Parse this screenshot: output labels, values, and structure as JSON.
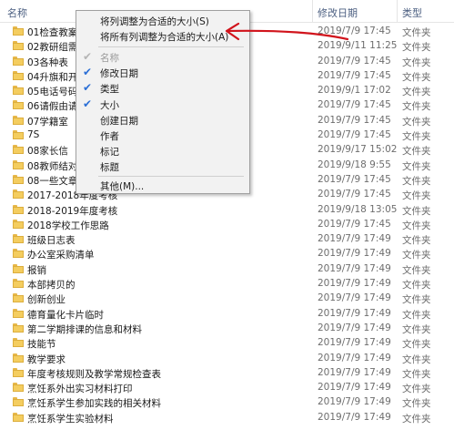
{
  "header": {
    "name_label": "名称",
    "date_label": "修改日期",
    "type_label": "类型"
  },
  "files": [
    {
      "name": "01检查教案、",
      "date": "2019/7/9 17:45",
      "type": "文件夹"
    },
    {
      "name": "02教研组需要",
      "date": "2019/9/11 11:25",
      "type": "文件夹"
    },
    {
      "name": "03各种表",
      "date": "2019/7/9 17:45",
      "type": "文件夹"
    },
    {
      "name": "04升旗和开会",
      "date": "2019/7/9 17:45",
      "type": "文件夹"
    },
    {
      "name": "05电话号码",
      "date": "2019/9/1 17:02",
      "type": "文件夹"
    },
    {
      "name": "06请假由请表",
      "date": "2019/7/9 17:45",
      "type": "文件夹"
    },
    {
      "name": "07学籍室",
      "date": "2019/7/9 17:45",
      "type": "文件夹"
    },
    {
      "name": "7S",
      "date": "2019/7/9 17:45",
      "type": "文件夹"
    },
    {
      "name": "08家长信",
      "date": "2019/9/17 15:02",
      "type": "文件夹"
    },
    {
      "name": "08教师结对子",
      "date": "2019/9/18 9:55",
      "type": "文件夹"
    },
    {
      "name": "08一些文章",
      "date": "2019/7/9 17:45",
      "type": "文件夹"
    },
    {
      "name": "2017-2018年度考核",
      "date": "2019/7/9 17:45",
      "type": "文件夹"
    },
    {
      "name": "2018-2019年度考核",
      "date": "2019/9/18 13:05",
      "type": "文件夹"
    },
    {
      "name": "2018学校工作思路",
      "date": "2019/7/9 17:45",
      "type": "文件夹"
    },
    {
      "name": "班级日志表",
      "date": "2019/7/9 17:49",
      "type": "文件夹"
    },
    {
      "name": "办公室采购清单",
      "date": "2019/7/9 17:49",
      "type": "文件夹"
    },
    {
      "name": "报销",
      "date": "2019/7/9 17:49",
      "type": "文件夹"
    },
    {
      "name": "本部拷贝的",
      "date": "2019/7/9 17:49",
      "type": "文件夹"
    },
    {
      "name": "创新创业",
      "date": "2019/7/9 17:49",
      "type": "文件夹"
    },
    {
      "name": "德育量化卡片临时",
      "date": "2019/7/9 17:49",
      "type": "文件夹"
    },
    {
      "name": "第二学期排课的信息和材料",
      "date": "2019/7/9 17:49",
      "type": "文件夹"
    },
    {
      "name": "技能节",
      "date": "2019/7/9 17:49",
      "type": "文件夹"
    },
    {
      "name": "教学要求",
      "date": "2019/7/9 17:49",
      "type": "文件夹"
    },
    {
      "name": "年度考核规则及教学常规检查表",
      "date": "2019/7/9 17:49",
      "type": "文件夹"
    },
    {
      "name": "烹饪系外出实习材料打印",
      "date": "2019/7/9 17:49",
      "type": "文件夹"
    },
    {
      "name": "烹饪系学生参加实践的相关材料",
      "date": "2019/7/9 17:49",
      "type": "文件夹"
    },
    {
      "name": "烹饪系学生实验材料",
      "date": "2019/7/9 17:49",
      "type": "文件夹"
    }
  ],
  "menu": {
    "size_column": "将列调整为合适的大小(S)",
    "size_all": "将所有列调整为合适的大小(A)",
    "items": [
      {
        "label": "名称",
        "checked": true,
        "disabled": true
      },
      {
        "label": "修改日期",
        "checked": true,
        "disabled": false
      },
      {
        "label": "类型",
        "checked": true,
        "disabled": false
      },
      {
        "label": "大小",
        "checked": true,
        "disabled": false
      },
      {
        "label": "创建日期",
        "checked": false,
        "disabled": false
      },
      {
        "label": "作者",
        "checked": false,
        "disabled": false
      },
      {
        "label": "标记",
        "checked": false,
        "disabled": false
      },
      {
        "label": "标题",
        "checked": false,
        "disabled": false
      }
    ],
    "more": "其他(M)...",
    "check_glyph": "✔"
  },
  "colors": {
    "accent_check": "#2b6fd6",
    "annotation_red": "#d1141c",
    "folder": "#f4cd5f"
  }
}
